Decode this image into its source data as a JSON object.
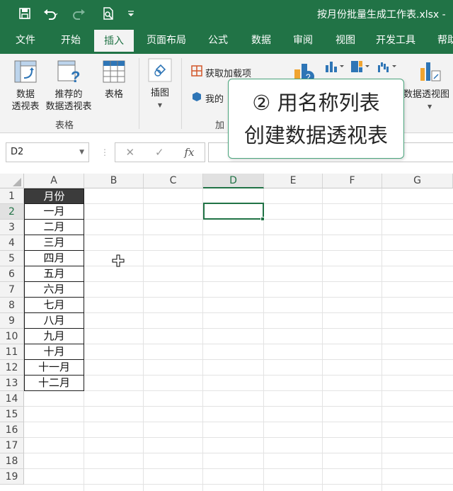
{
  "titlebar": {
    "filename": "按月份批量生成工作表.xlsx  -"
  },
  "tabs": [
    "文件",
    "开始",
    "插入",
    "页面布局",
    "公式",
    "数据",
    "审阅",
    "视图",
    "开发工具",
    "帮助"
  ],
  "ribbon": {
    "pivot_label_1": "数据",
    "pivot_label_2": "透视表",
    "rec_pivot_label_1": "推荐的",
    "rec_pivot_label_2": "数据透视表",
    "table_label": "表格",
    "tables_group": "表格",
    "illustrations_label": "插图",
    "get_addins": "获取加载项",
    "my_addins": "我的",
    "addins_group": "加",
    "pivot_chart_label": "数据透视图"
  },
  "callout": {
    "line1": "② 用名称列表",
    "line2": "创建数据透视表"
  },
  "formula_bar": {
    "name_box": "D2",
    "fx": "fx"
  },
  "columns": [
    "A",
    "B",
    "C",
    "D",
    "E",
    "F",
    "G"
  ],
  "rows": [
    "1",
    "2",
    "3",
    "4",
    "5",
    "6",
    "7",
    "8",
    "9",
    "10",
    "11",
    "12",
    "13",
    "14",
    "15",
    "16",
    "17",
    "18",
    "19"
  ],
  "colA": [
    "月份",
    "一月",
    "二月",
    "三月",
    "四月",
    "五月",
    "六月",
    "七月",
    "八月",
    "九月",
    "十月",
    "十一月",
    "十二月"
  ],
  "colors": {
    "accent": "#217346"
  }
}
